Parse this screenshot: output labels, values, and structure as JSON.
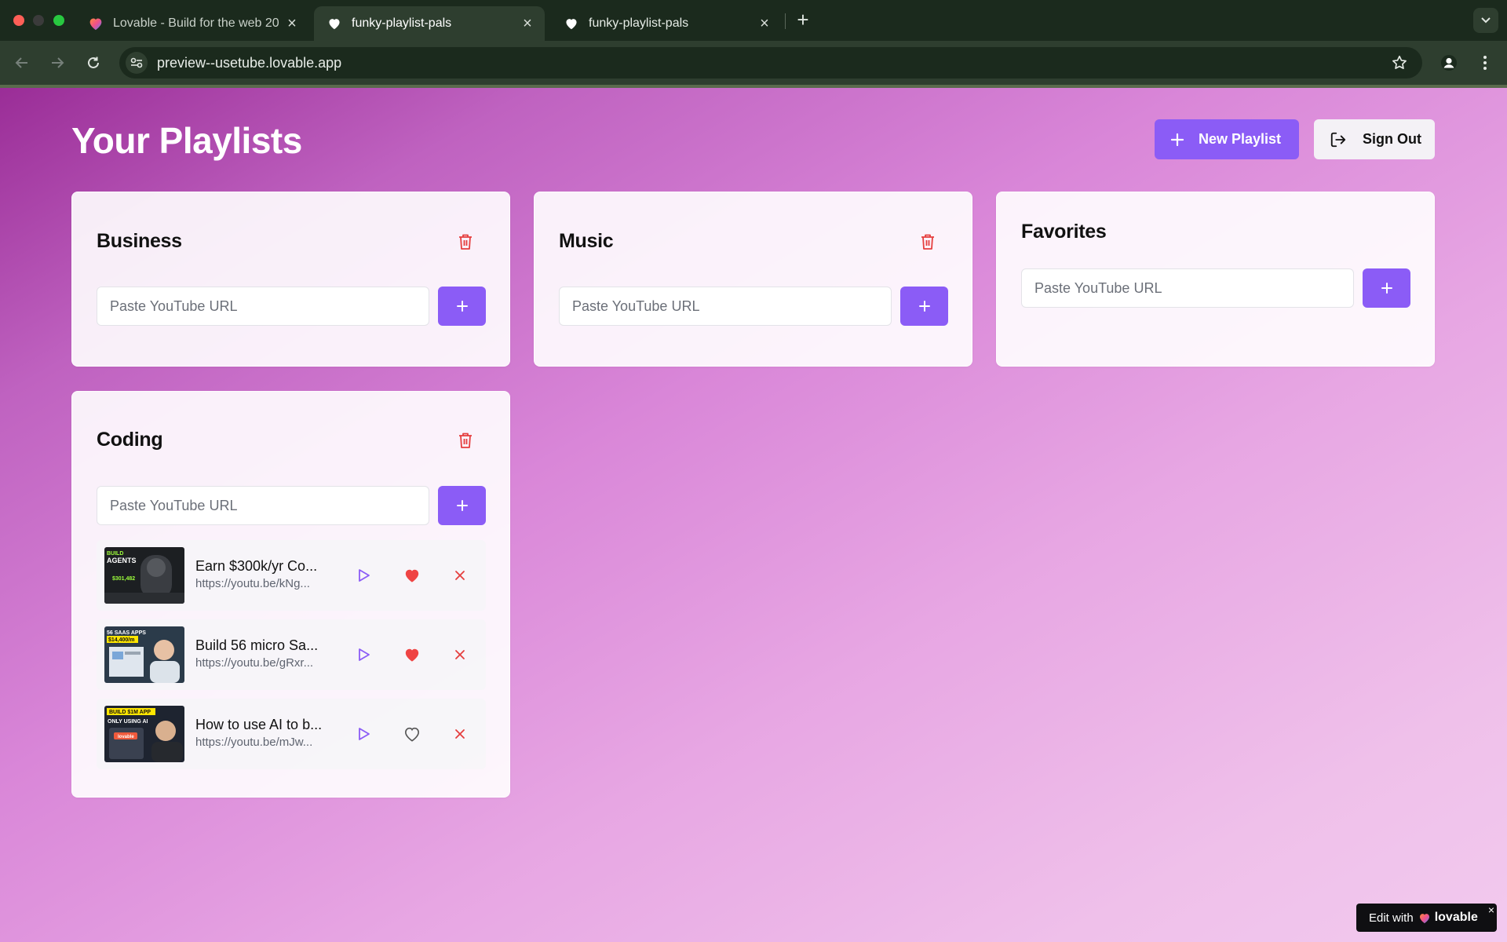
{
  "browser": {
    "tabs": [
      {
        "title": "Lovable - Build for the web 20",
        "icon": "lovable-heart-icon",
        "active": false
      },
      {
        "title": "funky-playlist-pals",
        "icon": "heart-icon",
        "active": true
      },
      {
        "title": "funky-playlist-pals",
        "icon": "heart-icon",
        "active": false
      }
    ],
    "url": "preview--usetube.lovable.app"
  },
  "header": {
    "title": "Your Playlists",
    "new_playlist_label": "New Playlist",
    "sign_out_label": "Sign Out"
  },
  "playlists": [
    {
      "name": "Business",
      "placeholder": "Paste YouTube URL",
      "deletable": true,
      "videos": []
    },
    {
      "name": "Music",
      "placeholder": "Paste YouTube URL",
      "deletable": true,
      "videos": []
    },
    {
      "name": "Favorites",
      "placeholder": "Paste YouTube URL",
      "deletable": false,
      "videos": []
    },
    {
      "name": "Coding",
      "placeholder": "Paste YouTube URL",
      "deletable": true,
      "videos": [
        {
          "title": "Earn $300k/yr Co...",
          "url": "https://youtu.be/kNg...",
          "favorited": true,
          "thumb_text": [
            "BUILD",
            "AGENTS",
            "$301,482"
          ]
        },
        {
          "title": "Build 56 micro Sa...",
          "url": "https://youtu.be/gRxr...",
          "favorited": true,
          "thumb_text": [
            "56 SAAS APPS",
            "$14,400/m"
          ]
        },
        {
          "title": "How to use AI to b...",
          "url": "https://youtu.be/mJw...",
          "favorited": false,
          "thumb_text": [
            "BUILD $1M APP",
            "ONLY USING AI",
            "lovable"
          ]
        }
      ]
    }
  ],
  "badge": {
    "prefix": "Edit with",
    "brand": "lovable",
    "close": "×"
  },
  "colors": {
    "accent": "#8b5cf6",
    "danger": "#e53e3e",
    "heart": "#ef4444"
  }
}
